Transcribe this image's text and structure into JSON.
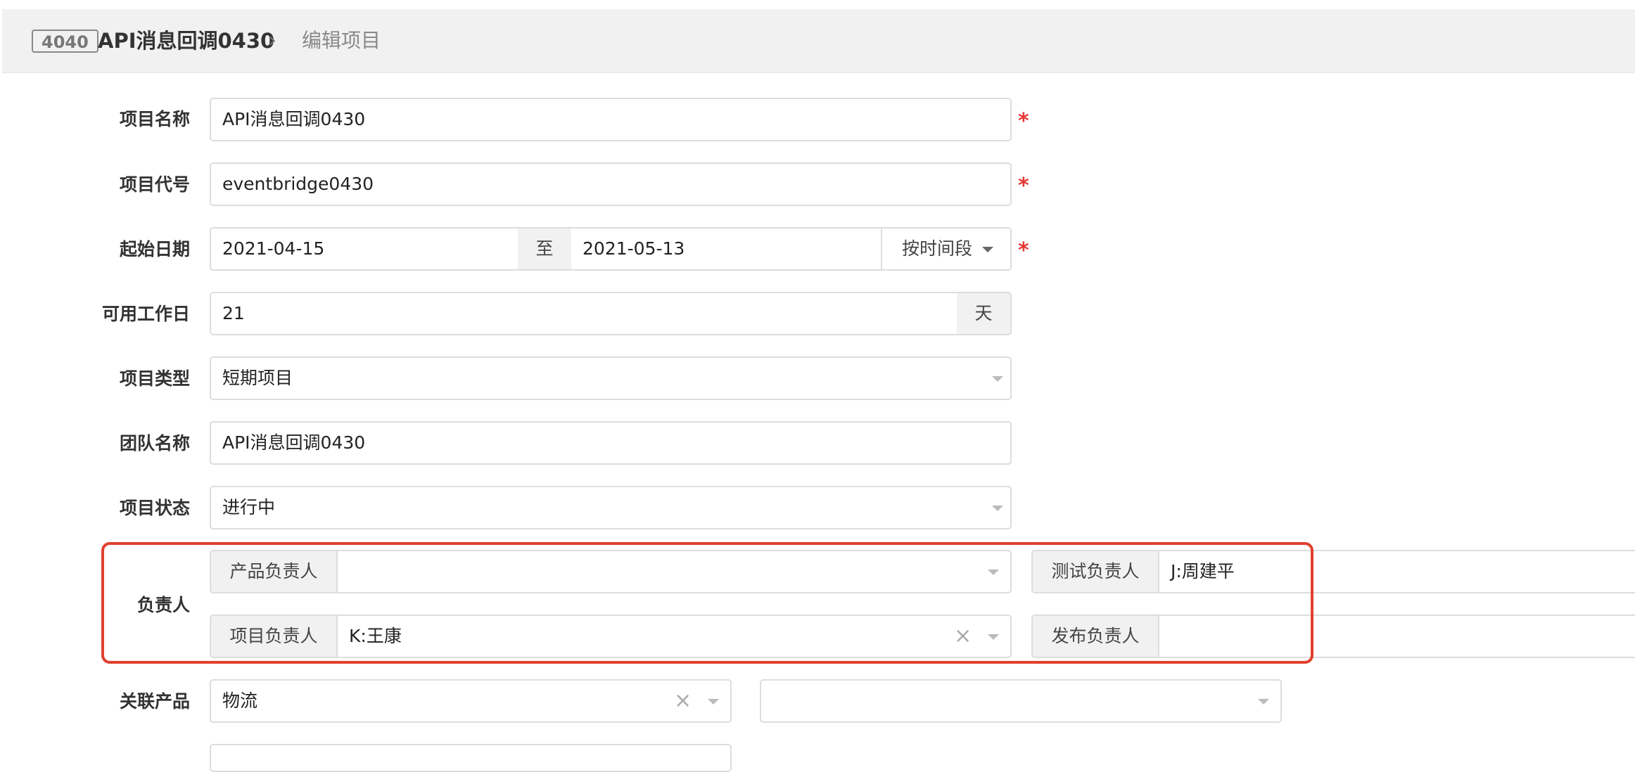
{
  "header": {
    "badge": "4040",
    "title": "API消息回调0430",
    "separator": "›",
    "page": "编辑项目"
  },
  "form": {
    "name": {
      "label": "项目名称",
      "value": "API消息回调0430",
      "required": "*"
    },
    "code": {
      "label": "项目代号",
      "value": "eventbridge0430",
      "required": "*"
    },
    "dates": {
      "label": "起始日期",
      "start": "2021-04-15",
      "to": "至",
      "end": "2021-05-13",
      "mode": "按时间段",
      "required": "*"
    },
    "workdays": {
      "label": "可用工作日",
      "value": "21",
      "unit": "天"
    },
    "type": {
      "label": "项目类型",
      "value": "短期项目"
    },
    "team": {
      "label": "团队名称",
      "value": "API消息回调0430"
    },
    "status": {
      "label": "项目状态",
      "value": "进行中"
    },
    "owners": {
      "label": "负责人",
      "product": {
        "label": "产品负责人",
        "value": ""
      },
      "test": {
        "label": "测试负责人",
        "value": "J:周建平"
      },
      "project": {
        "label": "项目负责人",
        "value": "K:王康"
      },
      "release": {
        "label": "发布负责人",
        "value": ""
      }
    },
    "related": {
      "label": "关联产品",
      "product": "物流",
      "branch": ""
    }
  },
  "icons": {
    "clear": "×",
    "dropdown": "chevron-down-icon"
  },
  "colors": {
    "required": "#e53935",
    "highlight": "#e0412f"
  }
}
